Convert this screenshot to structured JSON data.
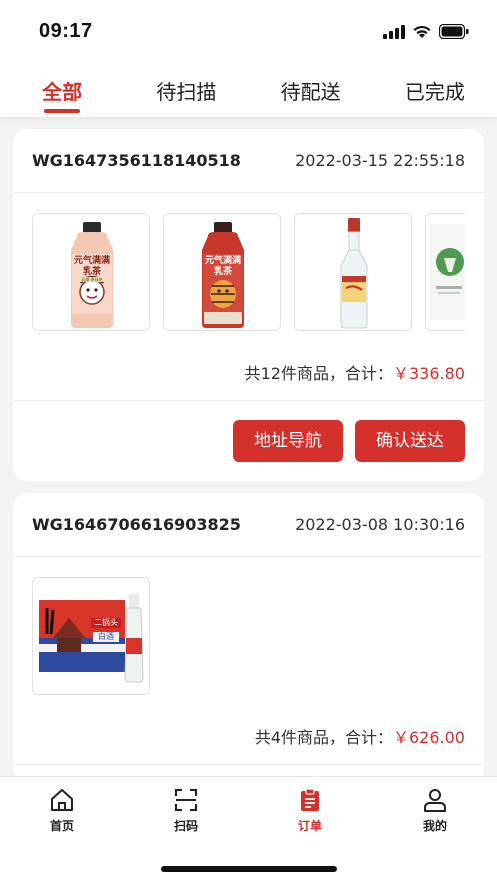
{
  "status_bar": {
    "time": "09:17"
  },
  "tabs": [
    {
      "label": "全部",
      "active": true
    },
    {
      "label": "待扫描",
      "active": false
    },
    {
      "label": "待配送",
      "active": false
    },
    {
      "label": "已完成",
      "active": false
    }
  ],
  "orders": [
    {
      "order_no": "WG1647356118140518",
      "date": "2022-03-15 22:55:18",
      "items": [
        {
          "product_text": "元气满满 乳茶",
          "badge_text": "乳酪·原味茶"
        },
        {
          "product_text": "元气满满 乳茶"
        },
        {
          "product_text": ""
        },
        {
          "product_text": ""
        }
      ],
      "summary_prefix": "共12件商品，合计：",
      "total": "￥336.80",
      "buttons": {
        "navigate": "地址导航",
        "confirm": "确认送达"
      }
    },
    {
      "order_no": "WG1646706616903825",
      "date": "2022-03-08 10:30:16",
      "items": [
        {
          "product_text": "二锅头",
          "label_text": "白酒"
        }
      ],
      "summary_prefix": "共4件商品，合计：",
      "total": "￥626.00"
    }
  ],
  "bottom_nav": [
    {
      "label": "首页",
      "icon": "home-icon",
      "active": false
    },
    {
      "label": "扫码",
      "icon": "scan-icon",
      "active": false
    },
    {
      "label": "订单",
      "icon": "order-clipboard-icon",
      "active": true
    },
    {
      "label": "我的",
      "icon": "user-icon",
      "active": false
    }
  ],
  "colors": {
    "accent": "#d4312d",
    "background": "#f3f3f3",
    "card": "#ffffff"
  }
}
